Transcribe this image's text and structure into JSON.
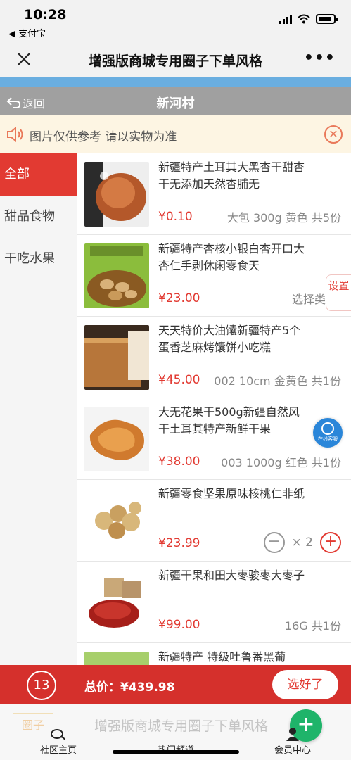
{
  "status_bar": {
    "time": "10:28",
    "back_app": "◀ 支付宝"
  },
  "nav": {
    "title": "增强版商城专用圈子下单风格",
    "more": "•••"
  },
  "sub_header": {
    "back_label": "返回",
    "title": "新河村"
  },
  "notice": {
    "text": "图片仅供参考 请以实物为准",
    "close": "✕"
  },
  "categories": [
    {
      "label": "全部",
      "active": true
    },
    {
      "label": "甜品食物",
      "active": false
    },
    {
      "label": "干吃水果",
      "active": false
    }
  ],
  "products": [
    {
      "name": "新疆特产土耳其大黑杏干甜杏干无添加天然杏脯无",
      "price": "¥0.10",
      "spec": "大包 300g 黄色 共5份"
    },
    {
      "name": "新疆特产杏核小银白杏开口大杏仁手剥休闲零食天",
      "price": "¥23.00",
      "spec": "选择类"
    },
    {
      "name": "天天特价大油馕新疆特产5个蛋香芝麻烤馕饼小吃糕",
      "price": "¥45.00",
      "spec": "002 10cm 金黄色 共1份"
    },
    {
      "name": "大无花果干500g新疆自然风干土耳其特产新鲜干果",
      "price": "¥38.00",
      "spec": "003 1000g 红色 共1份"
    },
    {
      "name": "新疆零食坚果原味核桃仁非纸",
      "price": "¥23.99",
      "qty": "× 2"
    },
    {
      "name": "新疆干果和田大枣骏枣大枣子",
      "price": "¥99.00",
      "spec": "16G 共1份"
    },
    {
      "name": "新疆特产 特级吐鲁番黑葡",
      "price": "",
      "spec": ""
    }
  ],
  "floating": {
    "settings": "设置",
    "customer_service": "在线客服"
  },
  "cart": {
    "count": "13",
    "total": "总价：¥439.98",
    "submit": "选好了"
  },
  "background_page": {
    "tag": "圈子",
    "title": "增强版商城专用圈子下单风格"
  },
  "tabbar": {
    "home": "社区主页",
    "hot": "热门频道",
    "member": "会员中心"
  },
  "colors": {
    "accent": "#e23a32",
    "notice_bg": "#fdf5e3",
    "fab": "#1fb46a",
    "strip": "#6aaee0"
  }
}
